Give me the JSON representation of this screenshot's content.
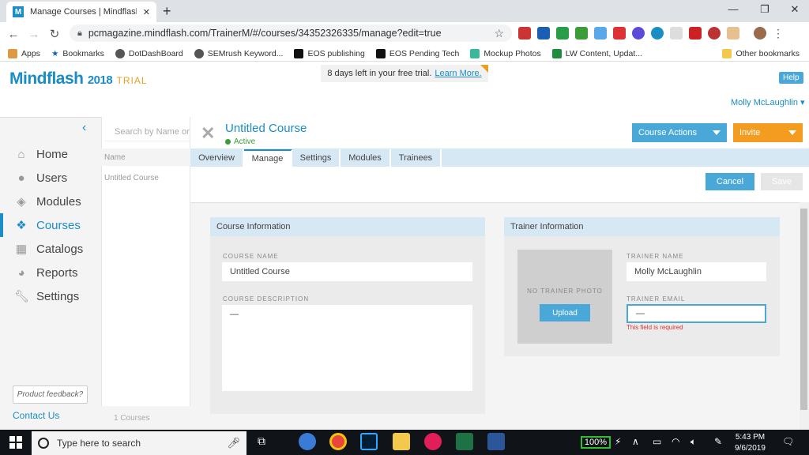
{
  "browser": {
    "tab_title": "Manage Courses | Mindflash Trai",
    "tab_favicon": "M",
    "url": "pcmagazine.mindflash.com/TrainerM/#/courses/34352326335/manage?edit=true",
    "bookmarks": [
      "Apps",
      "Bookmarks",
      "DotDashBoard",
      "SEMrush Keyword...",
      "EOS publishing",
      "EOS Pending Tech",
      "Mockup Photos",
      "LW Content, Updat..."
    ],
    "other_bookmarks": "Other bookmarks"
  },
  "app": {
    "logo": "Mindflash",
    "logo_year": "2018",
    "logo_trial": "TRIAL",
    "trial_notice": "8 days left in your free trial.",
    "trial_link": "Learn More.",
    "help": "Help",
    "user_name": "Molly McLaughlin"
  },
  "sidebar": {
    "items": [
      {
        "label": "Home",
        "icon": "home-icon"
      },
      {
        "label": "Users",
        "icon": "user-icon"
      },
      {
        "label": "Modules",
        "icon": "cube-icon"
      },
      {
        "label": "Courses",
        "icon": "cubes-icon"
      },
      {
        "label": "Catalogs",
        "icon": "grid-icon"
      },
      {
        "label": "Reports",
        "icon": "pie-chart-icon"
      },
      {
        "label": "Settings",
        "icon": "wrench-icon"
      }
    ],
    "feedback": "Product feedback?",
    "contact": "Contact Us"
  },
  "list": {
    "search_placeholder": "Search by Name or",
    "header": "Name",
    "item": "Untitled Course",
    "footer": "1 Courses"
  },
  "course": {
    "title": "Untitled Course",
    "status": "Active",
    "actions": "Course Actions",
    "invite": "Invite",
    "tabs": [
      "Overview",
      "Manage",
      "Settings",
      "Modules",
      "Trainees"
    ],
    "cancel": "Cancel",
    "save": "Save"
  },
  "course_info": {
    "header": "Course Information",
    "name_label": "COURSE NAME",
    "name_value": "Untitled Course",
    "desc_label": "COURSE DESCRIPTION",
    "desc_value": "—"
  },
  "trainer_info": {
    "header": "Trainer Information",
    "no_photo": "NO TRAINER PHOTO",
    "upload": "Upload",
    "name_label": "TRAINER NAME",
    "name_value": "Molly McLaughlin",
    "email_label": "TRAINER EMAIL",
    "email_value": "—",
    "error": "This field is required"
  },
  "taskbar": {
    "search": "Type here to search",
    "battery": "100%",
    "time": "5:43 PM",
    "date": "9/6/2019"
  },
  "colors": {
    "brand": "#1a8dc6",
    "accent_orange": "#f39c1f",
    "tab_bg": "#d6e8f4"
  }
}
